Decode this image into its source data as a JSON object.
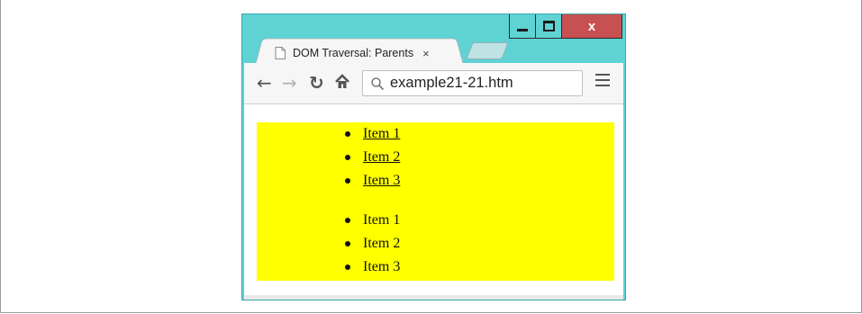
{
  "window": {
    "caption": {
      "close_label": "x"
    }
  },
  "tabs": [
    {
      "title": "DOM Traversal: Parents",
      "close": "×"
    }
  ],
  "toolbar": {
    "back_icon": "arrow-left-icon",
    "forward_icon": "arrow-right-icon",
    "reload_icon": "reload-icon",
    "home_icon": "home-icon",
    "url": "example21-21.htm",
    "menu_icon": "hamburger-menu-icon"
  },
  "content": {
    "background_color": "#ffff00",
    "link_list": [
      "Item 1",
      "Item 2",
      "Item 3"
    ],
    "text_list": [
      "Item 1",
      "Item 2",
      "Item 3"
    ]
  },
  "colors": {
    "window_frame": "#5fd2d4",
    "close_button": "#c75050"
  }
}
